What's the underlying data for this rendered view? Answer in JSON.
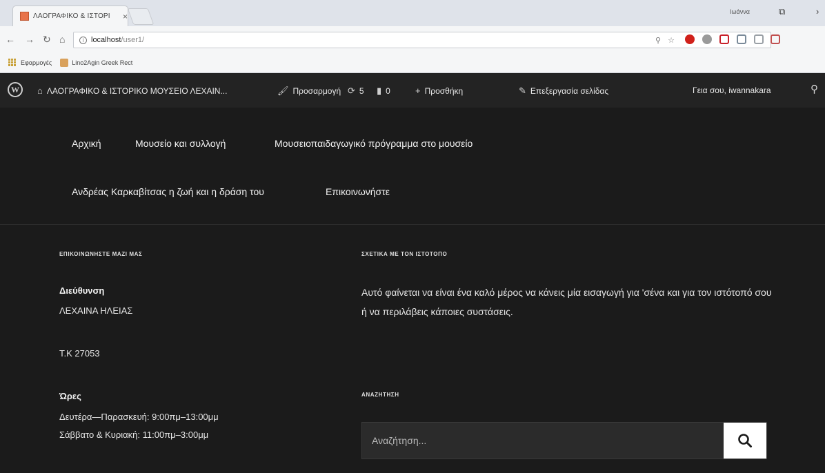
{
  "browser": {
    "tab_title": "ΛΑΟΓΡΑΦΙΚΟ & ΙΣΤΟΡΙ",
    "tab_close": "×",
    "profile_name": "Ιωάννα",
    "url_host": "localhost",
    "url_path": "/user1/",
    "bookmarks": [
      "Εφαρμογές",
      "Lino2Agin Greek Rect"
    ]
  },
  "admin_bar": {
    "site_name": "ΛΑΟΓΡΑΦΙΚΟ & ΙΣΤΟΡΙΚΟ ΜΟΥΣΕΙΟ ΛΕΧΑΙΝ...",
    "customize": "Προσαρμογή",
    "updates_count": "5",
    "comments_count": "0",
    "new": "Προσθήκη",
    "edit_page": "Επεξεργασία σελίδας",
    "greeting": "Γεια σου, iwannakara"
  },
  "nav": {
    "items": [
      "Αρχική",
      "Μουσείο και συλλογή",
      "Μουσειοπαιδαγωγικό πρόγραμμα στο μουσείο",
      "Ανδρέας Καρκαβίτσας η ζωή και η δράση του",
      "Επικοινωνήστε"
    ]
  },
  "footer": {
    "contact_title": "ΕΠΙΚΟΙΝΩΝΗΣΤΕ ΜΑΖΙ ΜΑΣ",
    "address_label": "Διεύθυνση",
    "address_value": "ΛΕΧΑΙΝΑ ΗΛΕΙΑΣ",
    "postal_code": "T.K 27053",
    "hours_label": "Ώρες",
    "hours_weekdays": "Δευτέρα—Παρασκευή: 9:00πμ–13:00μμ",
    "hours_weekend": "Σάββατο & Κυριακή: 11:00πμ–3:00μμ",
    "about_title": "ΣΧΕΤΙΚΑ ΜΕ ΤΟΝ ΙΣΤΟΤΟΠΟ",
    "about_text": "Αυτό φαίνεται να είναι ένα καλό μέρος να κάνεις μία εισαγωγή για 'σένα και για τον ιστότοπό σου ή να περιλάβεις κάποιες συστάσεις.",
    "search_title": "ΑΝΑΖΗΤΗΣΗ",
    "search_placeholder": "Αναζήτηση..."
  },
  "colors": {
    "page_bg": "#1b1b1b",
    "admin_bar_bg": "#232323",
    "search_button_bg": "#ffffff"
  }
}
